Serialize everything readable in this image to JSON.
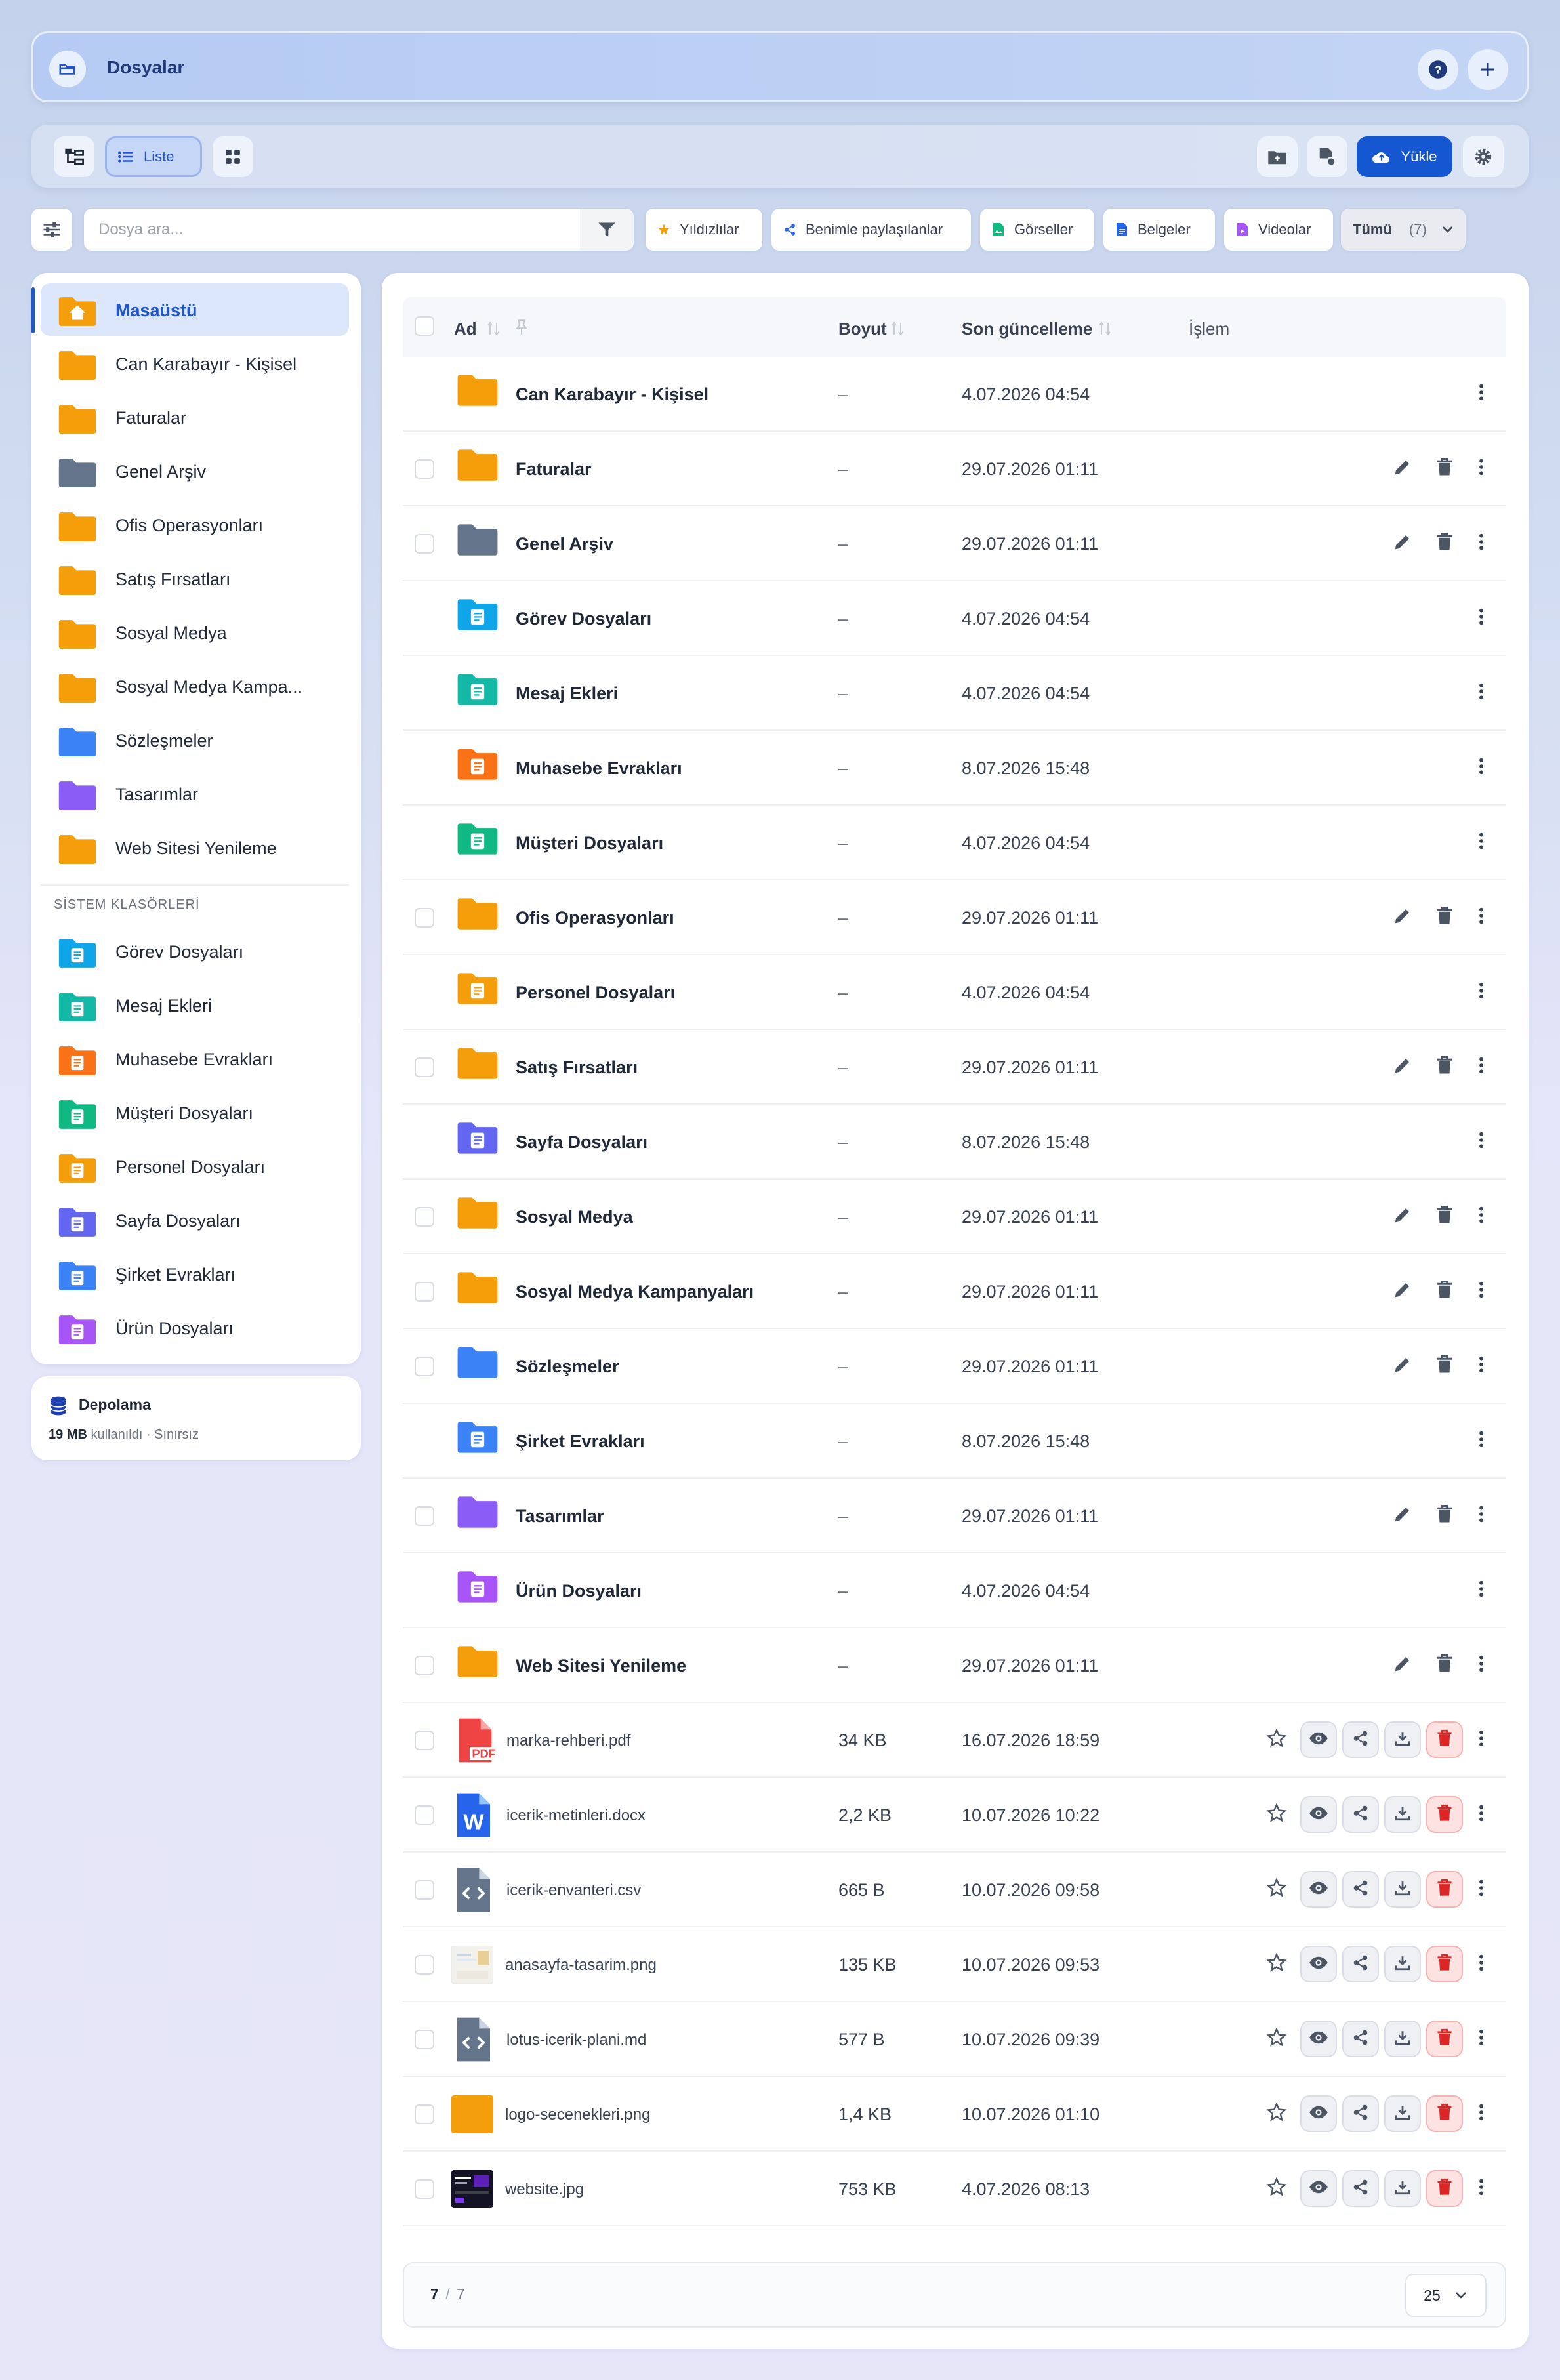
{
  "header": {
    "title": "Dosyalar",
    "icons": [
      "folder-open-icon",
      "help-icon",
      "plus-icon"
    ]
  },
  "toolbar": {
    "list_label": "Liste",
    "upload_label": "Yükle"
  },
  "search": {
    "placeholder": "Dosya ara..."
  },
  "filters": {
    "starred": "Yıldızlılar",
    "shared": "Benimle paylaşılanlar",
    "images": "Görseller",
    "docs": "Belgeler",
    "videos": "Videolar",
    "all": "Tümü",
    "all_count": "(7)"
  },
  "sidebar": {
    "items": [
      {
        "label": "Masaüstü",
        "color": "#f59e0b"
      },
      {
        "label": "Can Karabayır - Kişisel",
        "color": "#f59e0b"
      },
      {
        "label": "Faturalar",
        "color": "#f59e0b"
      },
      {
        "label": "Genel Arşiv",
        "color": "#64748b"
      },
      {
        "label": "Ofis Operasyonları",
        "color": "#f59e0b"
      },
      {
        "label": "Satış Fırsatları",
        "color": "#f59e0b"
      },
      {
        "label": "Sosyal Medya",
        "color": "#f59e0b"
      },
      {
        "label": "Sosyal Medya Kampa...",
        "color": "#f59e0b"
      },
      {
        "label": "Sözleşmeler",
        "color": "#3b82f6"
      },
      {
        "label": "Tasarımlar",
        "color": "#8b5cf6"
      },
      {
        "label": "Web Sitesi Yenileme",
        "color": "#f59e0b"
      }
    ],
    "system_heading": "SİSTEM KLASÖRLERİ",
    "system_items": [
      {
        "label": "Görev Dosyaları",
        "color": "#0ea5e9"
      },
      {
        "label": "Mesaj Ekleri",
        "color": "#14b8a6"
      },
      {
        "label": "Muhasebe Evrakları",
        "color": "#f97316"
      },
      {
        "label": "Müşteri Dosyaları",
        "color": "#10b981"
      },
      {
        "label": "Personel Dosyaları",
        "color": "#f59e0b"
      },
      {
        "label": "Sayfa Dosyaları",
        "color": "#6366f1"
      },
      {
        "label": "Şirket Evrakları",
        "color": "#3b82f6"
      },
      {
        "label": "Ürün Dosyaları",
        "color": "#a855f7"
      }
    ]
  },
  "storage": {
    "title": "Depolama",
    "used": "19 MB",
    "used_suffix": "kullanıldı · Sınırsız"
  },
  "table": {
    "headers": {
      "name": "Ad",
      "size": "Boyut",
      "updated": "Son güncelleme",
      "action": "İşlem"
    },
    "rows": [
      {
        "name": "Can Karabayır - Kişisel",
        "size": "–",
        "date": "4.07.2026 04:54",
        "color": "#f59e0b",
        "kind": "folder",
        "editable": false,
        "check": false
      },
      {
        "name": "Faturalar",
        "size": "–",
        "date": "29.07.2026 01:11",
        "color": "#f59e0b",
        "kind": "folder",
        "editable": true,
        "check": true
      },
      {
        "name": "Genel Arşiv",
        "size": "–",
        "date": "29.07.2026 01:11",
        "color": "#64748b",
        "kind": "folder",
        "editable": true,
        "check": true
      },
      {
        "name": "Görev Dosyaları",
        "size": "–",
        "date": "4.07.2026 04:54",
        "color": "#0ea5e9",
        "kind": "sys",
        "editable": false,
        "check": false
      },
      {
        "name": "Mesaj Ekleri",
        "size": "–",
        "date": "4.07.2026 04:54",
        "color": "#14b8a6",
        "kind": "sys",
        "editable": false,
        "check": false
      },
      {
        "name": "Muhasebe Evrakları",
        "size": "–",
        "date": "8.07.2026 15:48",
        "color": "#f97316",
        "kind": "sys",
        "editable": false,
        "check": false
      },
      {
        "name": "Müşteri Dosyaları",
        "size": "–",
        "date": "4.07.2026 04:54",
        "color": "#10b981",
        "kind": "sys",
        "editable": false,
        "check": false
      },
      {
        "name": "Ofis Operasyonları",
        "size": "–",
        "date": "29.07.2026 01:11",
        "color": "#f59e0b",
        "kind": "folder",
        "editable": true,
        "check": true
      },
      {
        "name": "Personel Dosyaları",
        "size": "–",
        "date": "4.07.2026 04:54",
        "color": "#f59e0b",
        "kind": "sys",
        "editable": false,
        "check": false
      },
      {
        "name": "Satış Fırsatları",
        "size": "–",
        "date": "29.07.2026 01:11",
        "color": "#f59e0b",
        "kind": "folder",
        "editable": true,
        "check": true
      },
      {
        "name": "Sayfa Dosyaları",
        "size": "–",
        "date": "8.07.2026 15:48",
        "color": "#6366f1",
        "kind": "sys",
        "editable": false,
        "check": false
      },
      {
        "name": "Sosyal Medya",
        "size": "–",
        "date": "29.07.2026 01:11",
        "color": "#f59e0b",
        "kind": "folder",
        "editable": true,
        "check": true
      },
      {
        "name": "Sosyal Medya Kampanyaları",
        "size": "–",
        "date": "29.07.2026 01:11",
        "color": "#f59e0b",
        "kind": "folder",
        "editable": true,
        "check": true
      },
      {
        "name": "Sözleşmeler",
        "size": "–",
        "date": "29.07.2026 01:11",
        "color": "#3b82f6",
        "kind": "folder",
        "editable": true,
        "check": true
      },
      {
        "name": "Şirket Evrakları",
        "size": "–",
        "date": "8.07.2026 15:48",
        "color": "#3b82f6",
        "kind": "sys",
        "editable": false,
        "check": false
      },
      {
        "name": "Tasarımlar",
        "size": "–",
        "date": "29.07.2026 01:11",
        "color": "#8b5cf6",
        "kind": "folder",
        "editable": true,
        "check": true
      },
      {
        "name": "Ürün Dosyaları",
        "size": "–",
        "date": "4.07.2026 04:54",
        "color": "#a855f7",
        "kind": "sys",
        "editable": false,
        "check": false
      },
      {
        "name": "Web Sitesi Yenileme",
        "size": "–",
        "date": "29.07.2026 01:11",
        "color": "#f59e0b",
        "kind": "folder",
        "editable": true,
        "check": true
      },
      {
        "name": "marka-rehberi.pdf",
        "size": "34 KB",
        "date": "16.07.2026 18:59",
        "kind": "pdf",
        "check": true
      },
      {
        "name": "icerik-metinleri.docx",
        "size": "2,2 KB",
        "date": "10.07.2026 10:22",
        "kind": "docx",
        "check": true
      },
      {
        "name": "icerik-envanteri.csv",
        "size": "665 B",
        "date": "10.07.2026 09:58",
        "kind": "code",
        "check": true
      },
      {
        "name": "anasayfa-tasarim.png",
        "size": "135 KB",
        "date": "10.07.2026 09:53",
        "kind": "thumb-light",
        "check": true
      },
      {
        "name": "lotus-icerik-plani.md",
        "size": "577 B",
        "date": "10.07.2026 09:39",
        "kind": "code",
        "check": true
      },
      {
        "name": "logo-secenekleri.png",
        "size": "1,4 KB",
        "date": "10.07.2026 01:10",
        "kind": "thumb-orange",
        "check": true
      },
      {
        "name": "website.jpg",
        "size": "753 KB",
        "date": "4.07.2026 08:13",
        "kind": "thumb-dark",
        "check": true
      }
    ]
  },
  "pager": {
    "current": "7",
    "sep": "/",
    "total": "7",
    "page_size": "25"
  }
}
